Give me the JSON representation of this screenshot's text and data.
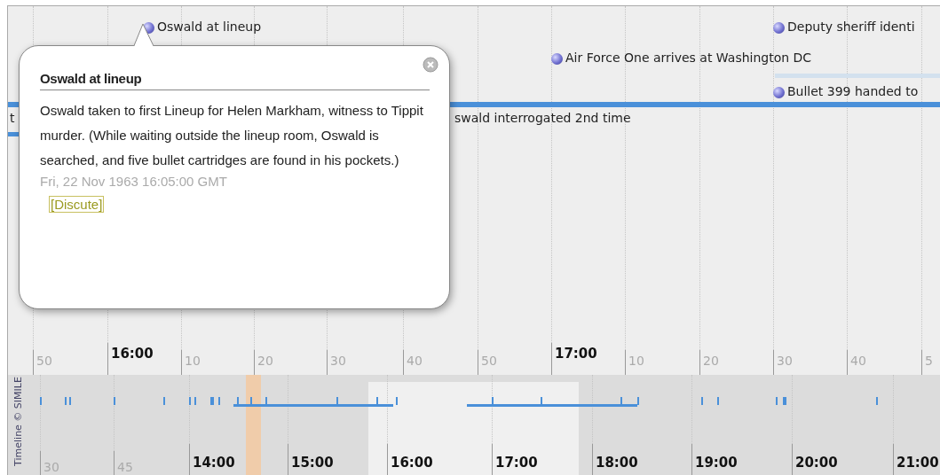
{
  "timeline": {
    "events": [
      {
        "title": "Oswald at lineup"
      },
      {
        "title": "Deputy sheriff identi"
      },
      {
        "title": "Air Force One arrives at Washington DC"
      },
      {
        "title": "Bullet 399 handed to"
      }
    ],
    "span_labels": [
      {
        "title": "t"
      },
      {
        "title": "swald interrogated 2nd time"
      }
    ],
    "scale": [
      {
        "label": "50",
        "kind": "minor"
      },
      {
        "label": "16:00",
        "kind": "major"
      },
      {
        "label": "10",
        "kind": "minor"
      },
      {
        "label": "20",
        "kind": "minor"
      },
      {
        "label": "30",
        "kind": "minor"
      },
      {
        "label": "40",
        "kind": "minor"
      },
      {
        "label": "50",
        "kind": "minor"
      },
      {
        "label": "17:00",
        "kind": "major"
      },
      {
        "label": "10",
        "kind": "minor"
      },
      {
        "label": "20",
        "kind": "minor"
      },
      {
        "label": "30",
        "kind": "minor"
      },
      {
        "label": "40",
        "kind": "minor"
      },
      {
        "label": "5",
        "kind": "minor"
      }
    ],
    "overview": {
      "credit": "Timeline © SIMILE",
      "scale": [
        {
          "label": "30",
          "kind": "minor"
        },
        {
          "label": "45",
          "kind": "minor"
        },
        {
          "label": "14:00",
          "kind": "major"
        },
        {
          "label": "15:00",
          "kind": "major"
        },
        {
          "label": "16:00",
          "kind": "major"
        },
        {
          "label": "17:00",
          "kind": "major"
        },
        {
          "label": "18:00",
          "kind": "major"
        },
        {
          "label": "19:00",
          "kind": "major"
        },
        {
          "label": "20:00",
          "kind": "major"
        },
        {
          "label": "21:00",
          "kind": "major"
        }
      ]
    }
  },
  "popup": {
    "title": "Oswald at lineup",
    "description": "Oswald taken to first Lineup for Helen Markham, witness to Tippit murder. (While waiting outside the lineup room, Oswald is searched, and five bullet cartridges are found in his pockets.)",
    "date": "Fri, 22 Nov 1963 16:05:00 GMT",
    "link": "[Discute]"
  }
}
